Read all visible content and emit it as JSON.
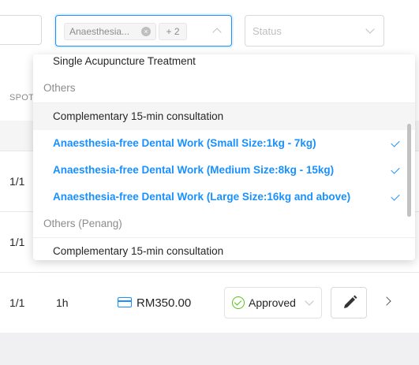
{
  "filters": {
    "category_select": {
      "selected_tag": "Anaesthesia...",
      "more_tag": "+ 2"
    },
    "status_select": {
      "placeholder": "Status"
    }
  },
  "table": {
    "header_spot": "SPOT",
    "rows": [
      {
        "spots": "1/1"
      },
      {
        "spots": "1/1"
      },
      {
        "spots": "1/1",
        "duration": "1h",
        "price": "RM350.00",
        "status": "Approved"
      }
    ]
  },
  "dropdown": {
    "options": [
      {
        "label": "Single Acupuncture Treatment",
        "type": "option",
        "selected": false
      },
      {
        "label": "Others",
        "type": "group"
      },
      {
        "label": "Complementary 15-min consultation",
        "type": "option",
        "selected": false
      },
      {
        "label": "Anaesthesia-free Dental Work (Small Size:1kg - 7kg)",
        "type": "option",
        "selected": true
      },
      {
        "label": "Anaesthesia-free Dental Work (Medium Size:8kg - 15kg)",
        "type": "option",
        "selected": true
      },
      {
        "label": "Anaesthesia-free Dental Work (Large Size:16kg and above)",
        "type": "option",
        "selected": true
      },
      {
        "label": "Others (Penang)",
        "type": "group"
      },
      {
        "label": "Complementary 15-min consultation",
        "type": "option",
        "selected": false
      }
    ]
  },
  "icons": {
    "tag_close": "close-icon",
    "select_arrow": "chevron-up-icon",
    "status_arrow": "chevron-down-icon",
    "check": "check-icon",
    "money": "credit-card-icon",
    "approved": "check-circle-icon",
    "edit": "pencil-icon",
    "row_expand": "chevron-right-icon"
  },
  "colors": {
    "accent": "#1890ff",
    "success": "#52c41a"
  }
}
